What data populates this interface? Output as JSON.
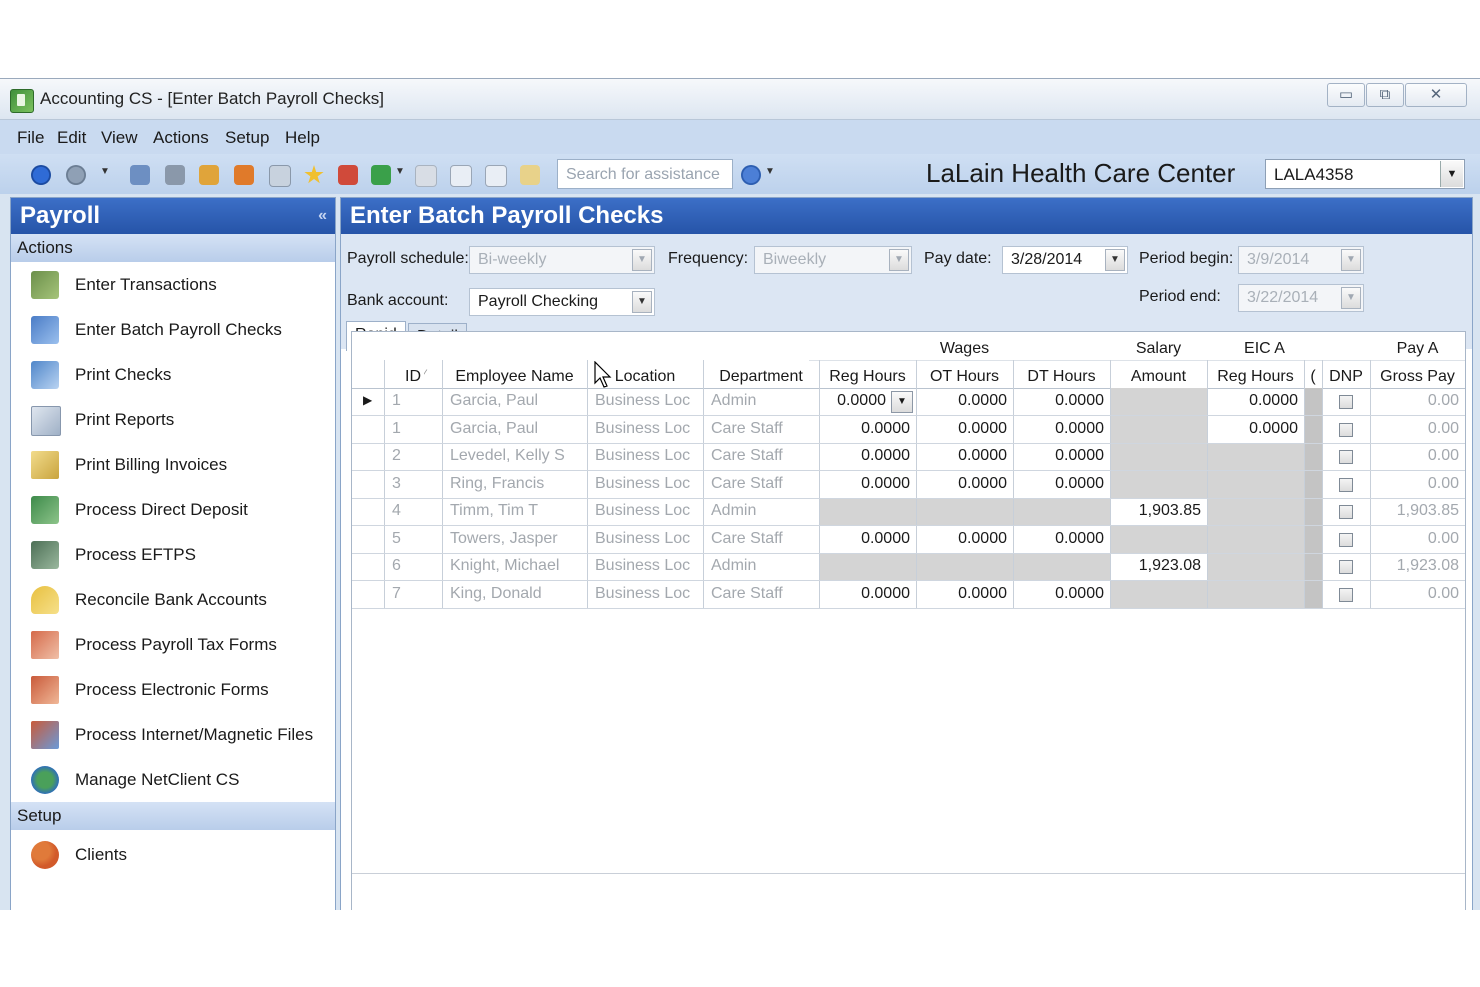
{
  "window": {
    "title": "Accounting CS - [Enter Batch Payroll Checks]",
    "minimize": "▭",
    "restore": "⧉",
    "close": "✕"
  },
  "menu": [
    "File",
    "Edit",
    "View",
    "Actions",
    "Setup",
    "Help"
  ],
  "toolbar": {
    "search_placeholder": "Search for assistance",
    "client_name": "LaLain Health Care Center",
    "client_code": "LALA4358"
  },
  "left_pane": {
    "title": "Payroll",
    "collapse_glyph": "«",
    "actions_header": "Actions",
    "actions": [
      {
        "label": "Enter Transactions",
        "icon": "pencil-book-icon"
      },
      {
        "label": "Enter Batch Payroll Checks",
        "icon": "batch-checks-icon"
      },
      {
        "label": "Print Checks",
        "icon": "print-checks-icon"
      },
      {
        "label": "Print Reports",
        "icon": "print-reports-icon"
      },
      {
        "label": "Print Billing Invoices",
        "icon": "invoice-icon"
      },
      {
        "label": "Process Direct Deposit",
        "icon": "direct-deposit-icon"
      },
      {
        "label": "Process EFTPS",
        "icon": "eftps-icon"
      },
      {
        "label": "Reconcile Bank Accounts",
        "icon": "scale-icon"
      },
      {
        "label": "Process Payroll Tax Forms",
        "icon": "tax-forms-icon"
      },
      {
        "label": "Process Electronic Forms",
        "icon": "electronic-forms-icon"
      },
      {
        "label": "Process Internet/Magnetic Files",
        "icon": "internet-files-icon"
      },
      {
        "label": "Manage NetClient CS",
        "icon": "globe-people-icon"
      }
    ],
    "setup_header": "Setup",
    "setup": [
      {
        "label": "Clients",
        "icon": "clients-icon"
      }
    ]
  },
  "main": {
    "title": "Enter Batch Payroll Checks",
    "form": {
      "payroll_schedule_label": "Payroll schedule:",
      "payroll_schedule_value": "Bi-weekly",
      "frequency_label": "Frequency:",
      "frequency_value": "Biweekly",
      "pay_date_label": "Pay date:",
      "pay_date_value": "3/28/2014",
      "period_begin_label": "Period begin:",
      "period_begin_value": "3/9/2014",
      "period_end_label": "Period end:",
      "period_end_value": "3/22/2014",
      "bank_account_label": "Bank account:",
      "bank_account_value": "Payroll Checking"
    },
    "tabs": [
      "Rapid",
      "Detail"
    ],
    "grid": {
      "group_headers": {
        "wages": "Wages",
        "salary": "Salary",
        "eic": "EIC A",
        "pay": "Pay A"
      },
      "columns": [
        "ID",
        "Employee Name",
        "Location",
        "Department",
        "Reg Hours",
        "OT Hours",
        "DT Hours",
        "Amount",
        "Reg Hours",
        "(",
        "DNP",
        "Gross Pay"
      ],
      "rows": [
        {
          "id": "1",
          "name": "Garcia, Paul",
          "location": "Business Loc",
          "dept": "Admin",
          "reg": "0.0000",
          "ot": "0.0000",
          "dt": "0.0000",
          "salary": "",
          "eic": "0.0000",
          "gross": "0.00"
        },
        {
          "id": "1",
          "name": "Garcia, Paul",
          "location": "Business Loc",
          "dept": "Care Staff",
          "reg": "0.0000",
          "ot": "0.0000",
          "dt": "0.0000",
          "salary": "",
          "eic": "0.0000",
          "gross": "0.00"
        },
        {
          "id": "2",
          "name": "Levedel, Kelly S",
          "location": "Business Loc",
          "dept": "Care Staff",
          "reg": "0.0000",
          "ot": "0.0000",
          "dt": "0.0000",
          "salary": "",
          "eic": "",
          "gross": "0.00"
        },
        {
          "id": "3",
          "name": "Ring, Francis",
          "location": "Business Loc",
          "dept": "Care Staff",
          "reg": "0.0000",
          "ot": "0.0000",
          "dt": "0.0000",
          "salary": "",
          "eic": "",
          "gross": "0.00"
        },
        {
          "id": "4",
          "name": "Timm, Tim T",
          "location": "Business Loc",
          "dept": "Admin",
          "reg": "",
          "ot": "",
          "dt": "",
          "salary": "1,903.85",
          "eic": "",
          "gross": "1,903.85"
        },
        {
          "id": "5",
          "name": "Towers, Jasper",
          "location": "Business Loc",
          "dept": "Care Staff",
          "reg": "0.0000",
          "ot": "0.0000",
          "dt": "0.0000",
          "salary": "",
          "eic": "",
          "gross": "0.00"
        },
        {
          "id": "6",
          "name": "Knight, Michael",
          "location": "Business Loc",
          "dept": "Admin",
          "reg": "",
          "ot": "",
          "dt": "",
          "salary": "1,923.08",
          "eic": "",
          "gross": "1,923.08"
        },
        {
          "id": "7",
          "name": "King, Donald",
          "location": "Business Loc",
          "dept": "Care Staff",
          "reg": "0.0000",
          "ot": "0.0000",
          "dt": "0.0000",
          "salary": "",
          "eic": "",
          "gross": "0.00"
        }
      ]
    }
  }
}
